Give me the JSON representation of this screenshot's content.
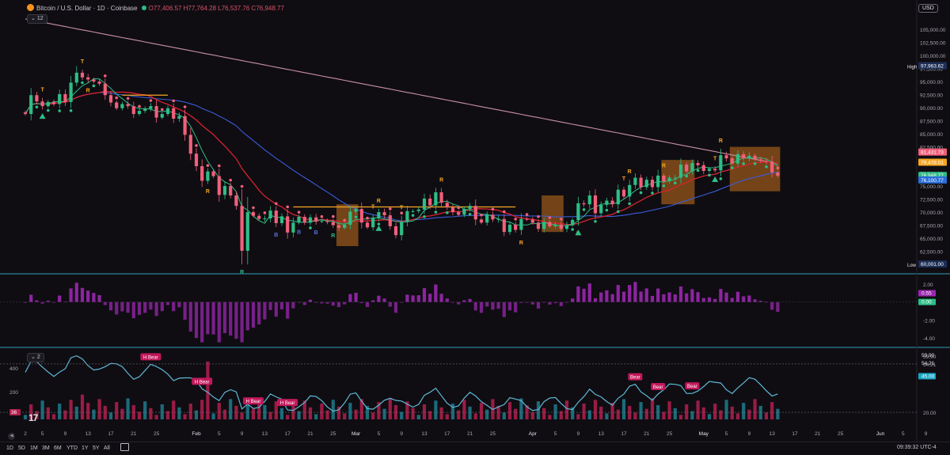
{
  "header": {
    "symbol_title": "Bitcoin / U.S. Dollar · 1D · Coinbase",
    "open": "O77,406.57",
    "high": "H77,764.28",
    "low": "L76,537.76",
    "close": "C76,948.77",
    "indicator_count": "12",
    "currency": "USD"
  },
  "colors": {
    "background": "#0f0d12",
    "up": "#2ebd85",
    "down": "#f0607a",
    "sma_red": "#d8222e",
    "ema_blue": "#3a5cd9",
    "long_ma": "#c98fa3",
    "orange_level": "#f5a623",
    "box_orange": "#c8721e",
    "macd_purple": "#9b27b0",
    "rsi_line": "#5fb8d6",
    "divider": "#2fa0b8"
  },
  "chart_data": [
    {
      "type": "candlestick",
      "title": "Bitcoin / U.S. Dollar · 1D · Coinbase",
      "ylim": [
        58500,
        108500
      ],
      "y_ticks": [
        "105,000.00",
        "102,500.00",
        "100,000.00",
        "97,500.00",
        "95,000.00",
        "92,500.00",
        "90,000.00",
        "87,500.00",
        "85,000.00",
        "82,500.00",
        "80,000.00",
        "77,500.00",
        "75,000.00",
        "72,500.00",
        "70,000.00",
        "67,500.00",
        "65,000.00",
        "62,500.00"
      ],
      "price_labels": [
        {
          "text": "97,963.62",
          "tag": "High",
          "value": 97963.62,
          "color": "#1d2f57"
        },
        {
          "text": "81,431.73",
          "value": 81431.73,
          "color": "#f0607a"
        },
        {
          "text": "79,478.01",
          "value": 79478.01,
          "color": "#f5a623"
        },
        {
          "text": "76,948.77",
          "value": 76948.77,
          "color": "#2ebd85"
        },
        {
          "text": "76,100.77",
          "value": 76100.77,
          "color": "#2a6fd9"
        },
        {
          "text": "60,001.00",
          "tag": "Low",
          "value": 60001.0,
          "color": "#1d2f57"
        }
      ],
      "closes": [
        88800,
        92400,
        91200,
        90300,
        91100,
        90700,
        92600,
        91100,
        94800,
        96700,
        95800,
        95400,
        95000,
        94600,
        92400,
        91000,
        89900,
        90700,
        90300,
        88800,
        89400,
        89800,
        90300,
        88100,
        88800,
        89900,
        87900,
        88400,
        84800,
        81200,
        78800,
        76000,
        77800,
        76900,
        73300,
        75000,
        73200,
        71200,
        62600,
        70000,
        69300,
        68700,
        68800,
        70300,
        67900,
        69200,
        66100,
        68000,
        69100,
        68000,
        69000,
        68200,
        68300,
        68100,
        67500,
        67000,
        67600,
        70100,
        70600,
        68000,
        67100,
        68800,
        70000,
        69400,
        67300,
        65600,
        68200,
        70200,
        70200,
        70500,
        72600,
        71300,
        73800,
        71800,
        70900,
        70000,
        69500,
        70600,
        71200,
        68600,
        68000,
        69500,
        68600,
        68700,
        66200,
        67600,
        66600,
        68700,
        68600,
        68000,
        66800,
        68100,
        67300,
        67600,
        66800,
        67500,
        68500,
        71700,
        71500,
        73200,
        69800,
        71400,
        72200,
        71500,
        74300,
        73000,
        75200,
        76600,
        74800,
        76200,
        74800,
        77000,
        75900,
        76600,
        76600,
        79100,
        77800,
        79400,
        79000,
        77900,
        78300,
        78000,
        80900,
        80300,
        79300,
        81100,
        80300,
        80800,
        80100,
        79800,
        79700,
        77600,
        76948
      ],
      "macd": {
        "ylim": [
          -4.8,
          2.8
        ],
        "ticks": [
          "2.00",
          "-2.00",
          "-4.00"
        ],
        "labels": [
          {
            "text": "0.55",
            "color": "#9b27b0"
          },
          {
            "text": "0.00",
            "color": "#2ebd85"
          }
        ]
      },
      "rsi": {
        "ylim": [
          15,
          62
        ],
        "ticks_right": [
          "59.90",
          "54.21",
          "45.00",
          "20.00"
        ],
        "ticks_left": [
          "400",
          "200"
        ],
        "labels": [
          {
            "text": "59.90"
          },
          {
            "text": "54.21"
          },
          {
            "text": "45.00",
            "color": "#1aa7c4"
          }
        ],
        "left_value": "36",
        "count": "2",
        "bubble_bear": "Bear",
        "bubble_hbear": "H Bear"
      },
      "x_ticks": [
        {
          "label": "2",
          "i": 0
        },
        {
          "label": "5",
          "i": 3
        },
        {
          "label": "9",
          "i": 7
        },
        {
          "label": "13",
          "i": 11
        },
        {
          "label": "17",
          "i": 15
        },
        {
          "label": "21",
          "i": 19
        },
        {
          "label": "25",
          "i": 23
        },
        {
          "label": "Feb",
          "i": 30
        },
        {
          "label": "5",
          "i": 34
        },
        {
          "label": "9",
          "i": 38
        },
        {
          "label": "13",
          "i": 42
        },
        {
          "label": "17",
          "i": 46
        },
        {
          "label": "21",
          "i": 50
        },
        {
          "label": "25",
          "i": 54
        },
        {
          "label": "Mar",
          "i": 58
        },
        {
          "label": "5",
          "i": 62
        },
        {
          "label": "9",
          "i": 66
        },
        {
          "label": "13",
          "i": 70
        },
        {
          "label": "17",
          "i": 74
        },
        {
          "label": "21",
          "i": 78
        },
        {
          "label": "25",
          "i": 82
        },
        {
          "label": "Apr",
          "i": 89
        },
        {
          "label": "5",
          "i": 93
        },
        {
          "label": "9",
          "i": 97
        },
        {
          "label": "13",
          "i": 101
        },
        {
          "label": "17",
          "i": 105
        },
        {
          "label": "21",
          "i": 109
        },
        {
          "label": "25",
          "i": 113
        },
        {
          "label": "May",
          "i": 119
        },
        {
          "label": "5",
          "i": 123
        },
        {
          "label": "9",
          "i": 127
        },
        {
          "label": "13",
          "i": 131
        },
        {
          "label": "17",
          "i": 135
        },
        {
          "label": "21",
          "i": 139
        },
        {
          "label": "25",
          "i": 143
        },
        {
          "label": "Jun",
          "i": 150
        },
        {
          "label": "5",
          "i": 154
        },
        {
          "label": "9",
          "i": 158
        }
      ],
      "markers": [
        {
          "text": "T",
          "i": 3
        },
        {
          "text": "T",
          "i": 10
        },
        {
          "text": "R",
          "i": 11
        },
        {
          "text": "R",
          "i": 32
        },
        {
          "text": "R",
          "i": 38
        },
        {
          "text": "B",
          "i": 44
        },
        {
          "text": "B",
          "i": 48
        },
        {
          "text": "B",
          "i": 51
        },
        {
          "text": "R",
          "i": 54
        },
        {
          "text": "T",
          "i": 61
        },
        {
          "text": "R",
          "i": 62
        },
        {
          "text": "T",
          "i": 66
        },
        {
          "text": "R",
          "i": 73
        },
        {
          "text": "R",
          "i": 87
        },
        {
          "text": "R",
          "i": 97
        },
        {
          "text": "T",
          "i": 105
        },
        {
          "text": "R",
          "i": 106
        },
        {
          "text": "R",
          "i": 112
        },
        {
          "text": "T",
          "i": 121
        },
        {
          "text": "R",
          "i": 122
        }
      ]
    }
  ],
  "timeframes": [
    "1D",
    "5D",
    "1M",
    "3M",
    "6M",
    "YTD",
    "1Y",
    "5Y",
    "All"
  ],
  "clock": "09:39:32 UTC-4"
}
